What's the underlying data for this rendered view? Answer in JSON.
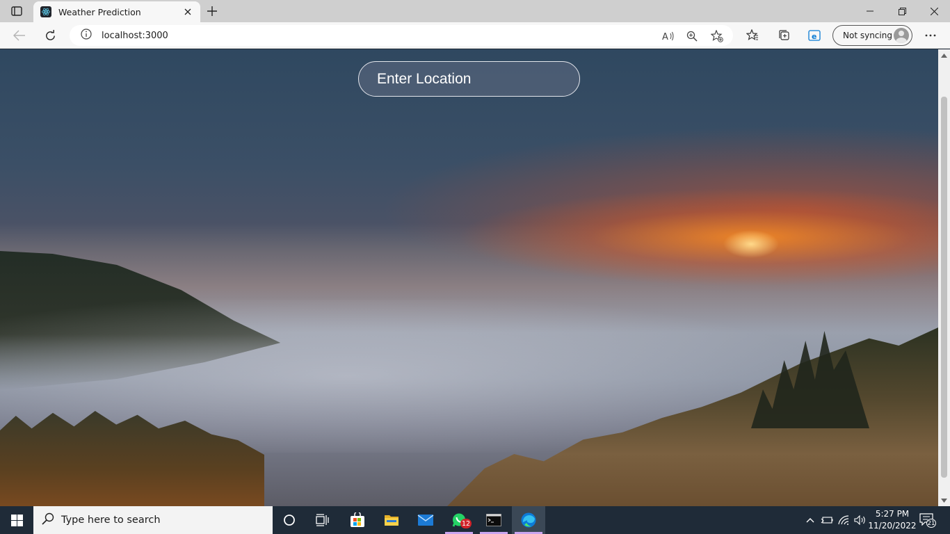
{
  "browser": {
    "tab": {
      "title": "Weather Prediction",
      "favicon": "react-icon"
    },
    "address": {
      "url": "localhost:3000"
    },
    "sync_label": "Not syncing"
  },
  "page": {
    "location_input": {
      "placeholder": "Enter Location",
      "value": ""
    }
  },
  "taskbar": {
    "search_placeholder": "Type here to search",
    "apps": [
      {
        "name": "cortana-icon"
      },
      {
        "name": "task-view-icon"
      },
      {
        "name": "microsoft-store-icon"
      },
      {
        "name": "file-explorer-icon"
      },
      {
        "name": "mail-icon"
      },
      {
        "name": "whatsapp-icon",
        "badge": "12"
      },
      {
        "name": "terminal-icon"
      },
      {
        "name": "edge-icon",
        "active": true
      }
    ],
    "clock": {
      "time": "5:27 PM",
      "date": "11/20/2022"
    },
    "notification_count": "21"
  },
  "colors": {
    "accent": "#0078d4",
    "taskbar": "#1f2b38",
    "input_border": "#e4e6ec",
    "badge_red": "#d1232a"
  }
}
